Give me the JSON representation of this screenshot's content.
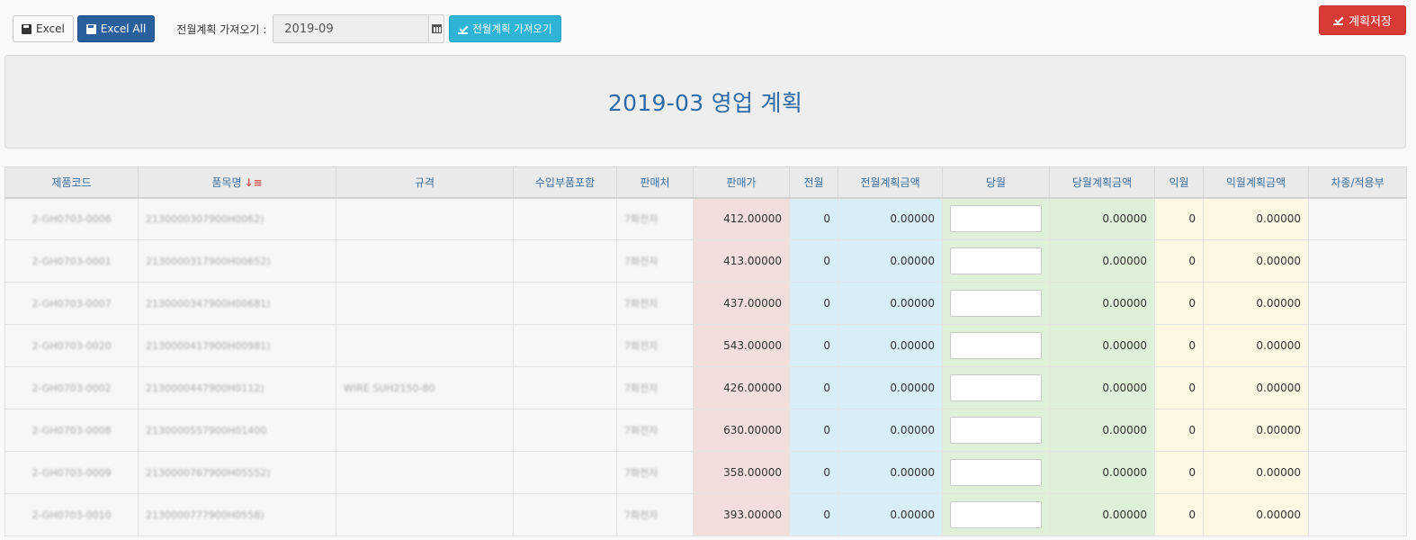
{
  "toolbar": {
    "excel_label": "Excel",
    "excel_all_label": "Excel All",
    "prev_plan_label": "전월계획 가져오기 :",
    "month_value": "2019-09",
    "load_prev_label": "전월계획 가져오기",
    "save_plan_label": "계획저장"
  },
  "banner": {
    "title": "2019-03 영업 계획"
  },
  "table": {
    "headers": [
      "제품코드",
      "품목명",
      "규격",
      "수입부품포함",
      "판매처",
      "판매가",
      "전월",
      "전월계획금액",
      "당월",
      "당월계획금액",
      "익월",
      "익월계획금액",
      "차종/적용부"
    ],
    "rows": [
      {
        "code": "2-GH0703-0006",
        "name": "2130000307900H0062)",
        "spec": "",
        "import": "",
        "seller": "7화전자",
        "price": "412.00000",
        "prev": "0",
        "prev_amt": "0.00000",
        "cur": "",
        "cur_amt": "0.00000",
        "next": "0",
        "next_amt": "0.00000",
        "car": ""
      },
      {
        "code": "2-GH0703-0001",
        "name": "2130000317900H00652)",
        "spec": "",
        "import": "",
        "seller": "7화전자",
        "price": "413.00000",
        "prev": "0",
        "prev_amt": "0.00000",
        "cur": "",
        "cur_amt": "0.00000",
        "next": "0",
        "next_amt": "0.00000",
        "car": ""
      },
      {
        "code": "2-GH0703-0007",
        "name": "2130000347900H00681)",
        "spec": "",
        "import": "",
        "seller": "7화전자",
        "price": "437.00000",
        "prev": "0",
        "prev_amt": "0.00000",
        "cur": "",
        "cur_amt": "0.00000",
        "next": "0",
        "next_amt": "0.00000",
        "car": ""
      },
      {
        "code": "2-GH0703-0020",
        "name": "2130000417900H00981)",
        "spec": "",
        "import": "",
        "seller": "7화전자",
        "price": "543.00000",
        "prev": "0",
        "prev_amt": "0.00000",
        "cur": "",
        "cur_amt": "0.00000",
        "next": "0",
        "next_amt": "0.00000",
        "car": ""
      },
      {
        "code": "2-GH0703-0002",
        "name": "2130000447900H0112)",
        "spec": "WIRE SUH2150-80",
        "import": "",
        "seller": "7화전자",
        "price": "426.00000",
        "prev": "0",
        "prev_amt": "0.00000",
        "cur": "",
        "cur_amt": "0.00000",
        "next": "0",
        "next_amt": "0.00000",
        "car": ""
      },
      {
        "code": "2-GH0703-0008",
        "name": "2130000557900H01400",
        "spec": "",
        "import": "",
        "seller": "7화전자",
        "price": "630.00000",
        "prev": "0",
        "prev_amt": "0.00000",
        "cur": "",
        "cur_amt": "0.00000",
        "next": "0",
        "next_amt": "0.00000",
        "car": ""
      },
      {
        "code": "2-GH0703-0009",
        "name": "2130000767900H05552)",
        "spec": "",
        "import": "",
        "seller": "7화전자",
        "price": "358.00000",
        "prev": "0",
        "prev_amt": "0.00000",
        "cur": "",
        "cur_amt": "0.00000",
        "next": "0",
        "next_amt": "0.00000",
        "car": ""
      },
      {
        "code": "2-GH0703-0010",
        "name": "2130000777900H0558)",
        "spec": "",
        "import": "",
        "seller": "7화전자",
        "price": "393.00000",
        "prev": "0",
        "prev_amt": "0.00000",
        "cur": "",
        "cur_amt": "0.00000",
        "next": "0",
        "next_amt": "0.00000",
        "car": ""
      }
    ]
  }
}
